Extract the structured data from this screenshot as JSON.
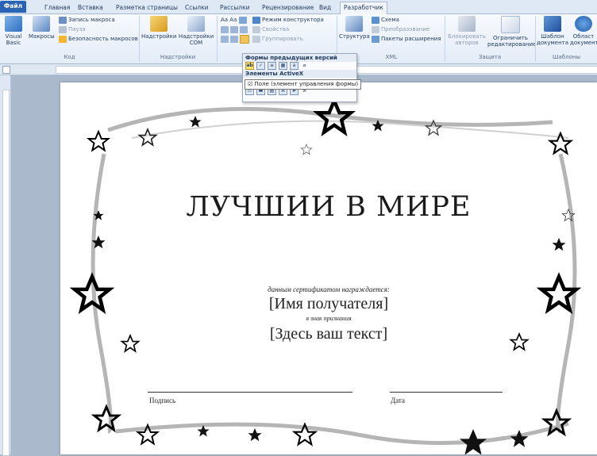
{
  "tabs": [
    "Файл",
    "Главная",
    "Вставка",
    "Разметка страницы",
    "Ссылки",
    "Рассылки",
    "Рецензирование",
    "Вид",
    "Разработчик"
  ],
  "ribbon": {
    "code": {
      "visual_basic": "Visual Basic",
      "macros": "Макросы",
      "record_macro": "Запись макроса",
      "pause": "Пауза",
      "macro_security": "Безопасность макросов",
      "group_label": "Код"
    },
    "addins": {
      "addins": "Надстройки",
      "com_addins": "Надстройки COM",
      "group_label": "Надстройки"
    },
    "controls": {
      "design_mode": "Режим конструктора",
      "properties": "Свойства",
      "group": "Группировать"
    },
    "xml": {
      "structure": "Структура",
      "schema": "Схема",
      "transform": "Преобразование",
      "expansion_packs": "Пакеты расширения",
      "group_label": "XML"
    },
    "protect": {
      "block_authors": "Блокировать авторов",
      "restrict_editing": "Ограничить редактирование",
      "group_label": "Защита"
    },
    "templates": {
      "doc_template": "Шаблон документа",
      "doc_panel": "Област документ",
      "group_label": "Шаблоны"
    }
  },
  "dropdown": {
    "legacy_header": "Формы предыдущих версий",
    "activex_header": "Элементы ActiveX",
    "tooltip": "Поле (элемент управления формы)"
  },
  "certificate": {
    "title": "ЛУЧШИИ В МИРЕ",
    "awarded_by": "данным сертификатом награждается:",
    "recipient": "[Имя получателя]",
    "in_recognition": "в знак признания",
    "text": "[Здесь ваш текст]",
    "signature": "Подпись",
    "date": "Дата"
  },
  "colors": {
    "file_tab": "#2a62b4",
    "ribbon_bg": "#e3ecf7",
    "page_bg": "#ffffff",
    "workspace": "#abb9cd"
  }
}
